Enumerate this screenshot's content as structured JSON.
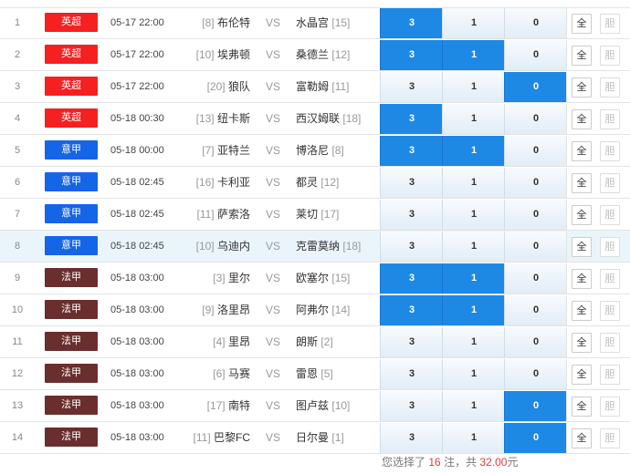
{
  "rows": [
    {
      "num": "1",
      "league": "英超",
      "league_color": "#f52020",
      "time": "05-17 22:00",
      "home_rank": "[8]",
      "home": "布伦特",
      "vs": "VS",
      "away": "水晶宫",
      "away_rank": "[15]",
      "o3": "3",
      "o1": "1",
      "o0": "0",
      "sel": [
        true,
        false,
        false
      ],
      "all": "全",
      "dan": "胆"
    },
    {
      "num": "2",
      "league": "英超",
      "league_color": "#f52020",
      "time": "05-17 22:00",
      "home_rank": "[10]",
      "home": "埃弗顿",
      "vs": "VS",
      "away": "桑德兰",
      "away_rank": "[12]",
      "o3": "3",
      "o1": "1",
      "o0": "0",
      "sel": [
        true,
        true,
        false
      ],
      "all": "全",
      "dan": "胆"
    },
    {
      "num": "3",
      "league": "英超",
      "league_color": "#f52020",
      "time": "05-17 22:00",
      "home_rank": "[20]",
      "home": "狼队",
      "vs": "VS",
      "away": "富勒姆",
      "away_rank": "[11]",
      "o3": "3",
      "o1": "1",
      "o0": "0",
      "sel": [
        false,
        false,
        true
      ],
      "all": "全",
      "dan": "胆"
    },
    {
      "num": "4",
      "league": "英超",
      "league_color": "#f52020",
      "time": "05-18 00:30",
      "home_rank": "[13]",
      "home": "纽卡斯",
      "vs": "VS",
      "away": "西汉姆联",
      "away_rank": "[18]",
      "o3": "3",
      "o1": "1",
      "o0": "0",
      "sel": [
        true,
        false,
        false
      ],
      "all": "全",
      "dan": "胆"
    },
    {
      "num": "5",
      "league": "意甲",
      "league_color": "#1565e8",
      "time": "05-18 00:00",
      "home_rank": "[7]",
      "home": "亚特兰",
      "vs": "VS",
      "away": "博洛尼",
      "away_rank": "[8]",
      "o3": "3",
      "o1": "1",
      "o0": "0",
      "sel": [
        true,
        true,
        false
      ],
      "all": "全",
      "dan": "胆"
    },
    {
      "num": "6",
      "league": "意甲",
      "league_color": "#1565e8",
      "time": "05-18 02:45",
      "home_rank": "[16]",
      "home": "卡利亚",
      "vs": "VS",
      "away": "都灵",
      "away_rank": "[12]",
      "o3": "3",
      "o1": "1",
      "o0": "0",
      "sel": [
        false,
        false,
        false
      ],
      "all": "全",
      "dan": "胆"
    },
    {
      "num": "7",
      "league": "意甲",
      "league_color": "#1565e8",
      "time": "05-18 02:45",
      "home_rank": "[11]",
      "home": "萨索洛",
      "vs": "VS",
      "away": "莱切",
      "away_rank": "[17]",
      "o3": "3",
      "o1": "1",
      "o0": "0",
      "sel": [
        false,
        false,
        false
      ],
      "all": "全",
      "dan": "胆"
    },
    {
      "num": "8",
      "league": "意甲",
      "league_color": "#1565e8",
      "time": "05-18 02:45",
      "home_rank": "[10]",
      "home": "乌迪内",
      "vs": "VS",
      "away": "克雷莫纳",
      "away_rank": "[18]",
      "o3": "3",
      "o1": "1",
      "o0": "0",
      "sel": [
        false,
        false,
        false
      ],
      "all": "全",
      "dan": "胆",
      "highlight": true
    },
    {
      "num": "9",
      "league": "法甲",
      "league_color": "#6b2e2e",
      "time": "05-18 03:00",
      "home_rank": "[3]",
      "home": "里尔",
      "vs": "VS",
      "away": "欧塞尔",
      "away_rank": "[15]",
      "o3": "3",
      "o1": "1",
      "o0": "0",
      "sel": [
        true,
        true,
        false
      ],
      "all": "全",
      "dan": "胆"
    },
    {
      "num": "10",
      "league": "法甲",
      "league_color": "#6b2e2e",
      "time": "05-18 03:00",
      "home_rank": "[9]",
      "home": "洛里昂",
      "vs": "VS",
      "away": "阿弗尔",
      "away_rank": "[14]",
      "o3": "3",
      "o1": "1",
      "o0": "0",
      "sel": [
        true,
        true,
        false
      ],
      "all": "全",
      "dan": "胆"
    },
    {
      "num": "11",
      "league": "法甲",
      "league_color": "#6b2e2e",
      "time": "05-18 03:00",
      "home_rank": "[4]",
      "home": "里昂",
      "vs": "VS",
      "away": "朗斯",
      "away_rank": "[2]",
      "o3": "3",
      "o1": "1",
      "o0": "0",
      "sel": [
        false,
        false,
        false
      ],
      "all": "全",
      "dan": "胆"
    },
    {
      "num": "12",
      "league": "法甲",
      "league_color": "#6b2e2e",
      "time": "05-18 03:00",
      "home_rank": "[6]",
      "home": "马赛",
      "vs": "VS",
      "away": "雷恩",
      "away_rank": "[5]",
      "o3": "3",
      "o1": "1",
      "o0": "0",
      "sel": [
        false,
        false,
        false
      ],
      "all": "全",
      "dan": "胆"
    },
    {
      "num": "13",
      "league": "法甲",
      "league_color": "#6b2e2e",
      "time": "05-18 03:00",
      "home_rank": "[17]",
      "home": "南特",
      "vs": "VS",
      "away": "图卢兹",
      "away_rank": "[10]",
      "o3": "3",
      "o1": "1",
      "o0": "0",
      "sel": [
        false,
        false,
        true
      ],
      "all": "全",
      "dan": "胆"
    },
    {
      "num": "14",
      "league": "法甲",
      "league_color": "#6b2e2e",
      "time": "05-18 03:00",
      "home_rank": "[11]",
      "home": "巴黎FC",
      "vs": "VS",
      "away": "日尔曼",
      "away_rank": "[1]",
      "o3": "3",
      "o1": "1",
      "o0": "0",
      "sel": [
        false,
        false,
        true
      ],
      "all": "全",
      "dan": "胆"
    }
  ],
  "summary": {
    "prefix": "您选择了",
    "count": "16",
    "mid": "注，共",
    "amount": "32.00",
    "suffix": "元"
  },
  "colors": {
    "selected": "#1e88e5",
    "premier": "#f52020",
    "serie_a": "#1565e8",
    "ligue1": "#6b2e2e"
  }
}
